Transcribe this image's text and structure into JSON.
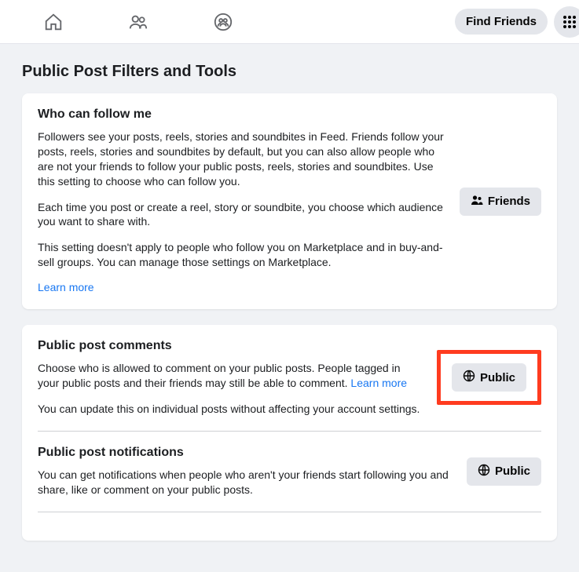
{
  "topbar": {
    "find_friends": "Find Friends"
  },
  "page": {
    "title": "Public Post Filters and Tools"
  },
  "follow": {
    "title": "Who can follow me",
    "p1": "Followers see your posts, reels, stories and soundbites in Feed. Friends follow your posts, reels, stories and soundbites by default, but you can also allow people who are not your friends to follow your public posts, reels, stories and soundbites. Use this setting to choose who can follow you.",
    "p2": "Each time you post or create a reel, story or soundbite, you choose which audience you want to share with.",
    "p3": "This setting doesn't apply to people who follow you on Marketplace and in buy-and-sell groups. You can manage those settings on Marketplace.",
    "learn": "Learn more",
    "selector": "Friends"
  },
  "comments": {
    "title": "Public post comments",
    "p1a": "Choose who is allowed to comment on your public posts. People tagged in your public posts and their friends may still be able to comment. ",
    "learn": "Learn more",
    "p2": "You can update this on individual posts without affecting your account settings.",
    "selector": "Public"
  },
  "notifications": {
    "title": "Public post notifications",
    "p1": "You can get notifications when people who aren't your friends start following you and share, like or comment on your public posts.",
    "selector": "Public"
  }
}
